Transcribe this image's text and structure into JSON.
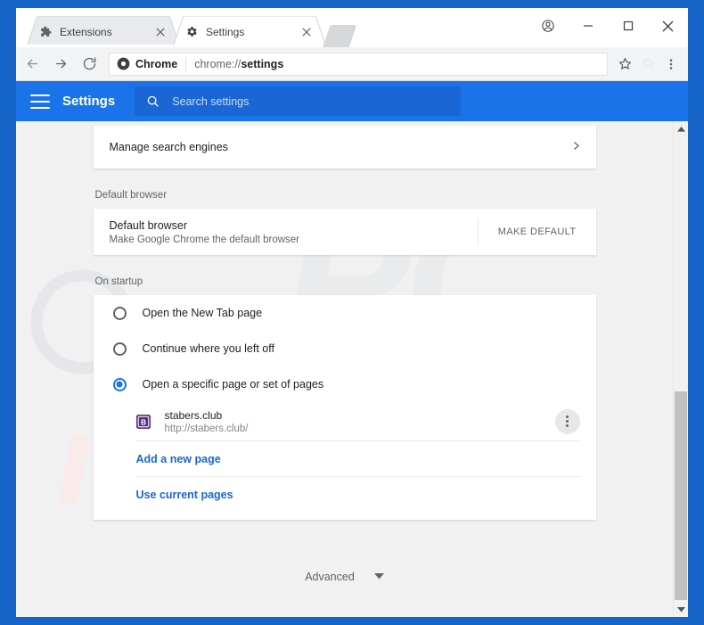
{
  "window": {
    "controls": [
      {
        "name": "profile",
        "glyph": "account-icon"
      },
      {
        "name": "minimize",
        "glyph": "minimize-icon"
      },
      {
        "name": "maximize",
        "glyph": "maximize-icon"
      },
      {
        "name": "close",
        "glyph": "close-icon"
      }
    ]
  },
  "tabs": [
    {
      "label": "Extensions",
      "favicon": "puzzle-icon",
      "active": false
    },
    {
      "label": "Settings",
      "favicon": "gear-icon",
      "active": true
    }
  ],
  "new_tab_button": "new-tab-button",
  "toolbar": {
    "back": "back-arrow-icon",
    "forward": "forward-arrow-icon",
    "reload": "reload-icon",
    "security_chip": "Chrome",
    "url_prefix": "chrome://",
    "url_bold": "settings",
    "url_full": "chrome://settings",
    "actions": [
      {
        "name": "bookmark-star-icon"
      },
      {
        "name": "extension-search-icon"
      },
      {
        "name": "chrome-menu-icon"
      }
    ]
  },
  "settings_header": {
    "menu_icon": "hamburger-icon",
    "title": "Settings",
    "search_icon": "search-icon",
    "search_placeholder": "Search settings",
    "search_value": ""
  },
  "search_engines_card": {
    "title": "Manage search engines",
    "chevron": "chevron-right-icon"
  },
  "default_browser": {
    "section_label": "Default browser",
    "title": "Default browser",
    "subtitle": "Make Google Chrome the default browser",
    "button": "MAKE DEFAULT"
  },
  "on_startup": {
    "section_label": "On startup",
    "options": [
      {
        "label": "Open the New Tab page",
        "selected": false
      },
      {
        "label": "Continue where you left off",
        "selected": false
      },
      {
        "label": "Open a specific page or set of pages",
        "selected": true
      }
    ],
    "pages": [
      {
        "name": "stabers.club",
        "url": "http://stabers.club/",
        "favicon_letter": "B",
        "favicon_color": "#5b2d82",
        "menu_icon": "kebab-menu-icon"
      }
    ],
    "add_page_link": "Add a new page",
    "use_current_link": "Use current pages"
  },
  "advanced": {
    "label": "Advanced",
    "caret": "chevron-down-icon"
  },
  "scrollbar": {
    "up_arrow": "scroll-up-icon",
    "down_arrow": "scroll-down-icon"
  },
  "watermark": {
    "top_text": "PC",
    "bottom_text": "risk.com",
    "top_color": "#e9eaec",
    "bottom_color": "#fbeeec"
  },
  "colors": {
    "frame_blue": "#1565c8",
    "header_blue": "#1a73e8",
    "search_blue": "#1966d4",
    "link_blue": "#1967d2",
    "accent": "#1a73e8"
  }
}
